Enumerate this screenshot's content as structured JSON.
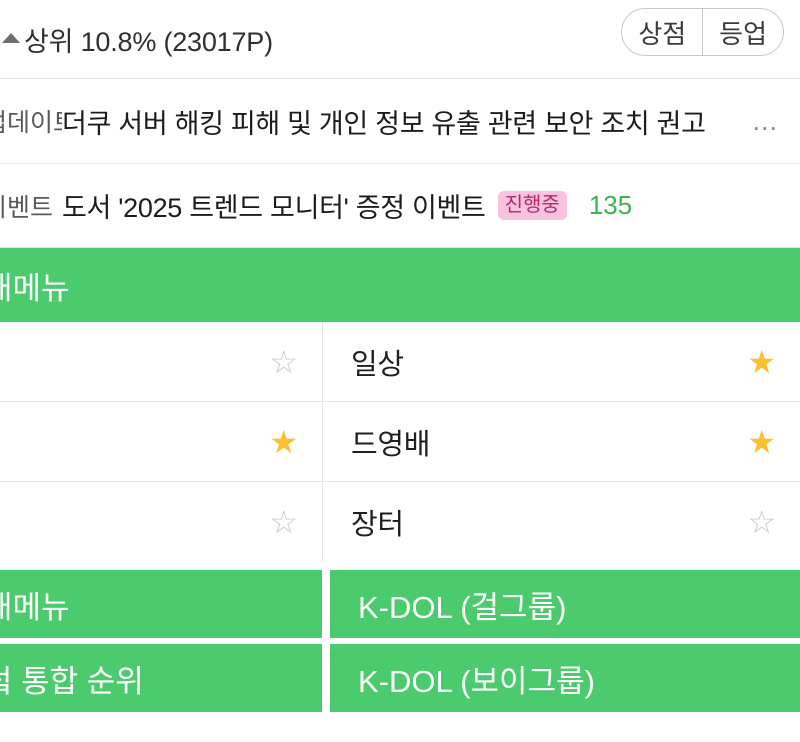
{
  "status": {
    "rank_text": "상위 10.8% (23017P)",
    "caret_icon": "triangle-up-icon",
    "buttons": [
      {
        "label": "상점"
      },
      {
        "label": "등업"
      }
    ]
  },
  "notices": [
    {
      "tag": "업데이트",
      "title": "더쿠 서버 해킹 피해 및 개인 정보 유출 관련 보안 조치 권고",
      "ellipsis": "...",
      "badge": "",
      "count": ""
    },
    {
      "tag": "이벤트",
      "title": "도서 '2025 트렌드 모니터' 증정 이벤트",
      "ellipsis": "",
      "badge": "진행중",
      "count": "135"
    }
  ],
  "section_header": {
    "label": "내메뉴"
  },
  "board": {
    "left_rows": [
      {
        "label": "",
        "star": "off",
        "has_star": false,
        "blank": true
      },
      {
        "label": "",
        "star": "on",
        "has_star": true,
        "blank": true
      },
      {
        "label": "",
        "star": "off",
        "has_star": true,
        "blank": true
      }
    ],
    "right_rows": [
      {
        "label": "일상",
        "star": "on"
      },
      {
        "label": "드영배",
        "star": "on"
      },
      {
        "label": "장터",
        "star": "off"
      }
    ]
  },
  "tiles": {
    "left": [
      {
        "label": "내메뉴"
      },
      {
        "label": "덬 통합 순위"
      }
    ],
    "right": [
      {
        "label": "K-DOL (걸그룹)"
      },
      {
        "label": "K-DOL (보이그룹)"
      }
    ]
  },
  "colors": {
    "green": "#4bcb6d",
    "star_on": "#fbc02d",
    "star_off": "#c9c9c9",
    "badge_bg": "#f9c2dd",
    "badge_fg": "#b3276c",
    "count_green": "#3ab54a"
  }
}
